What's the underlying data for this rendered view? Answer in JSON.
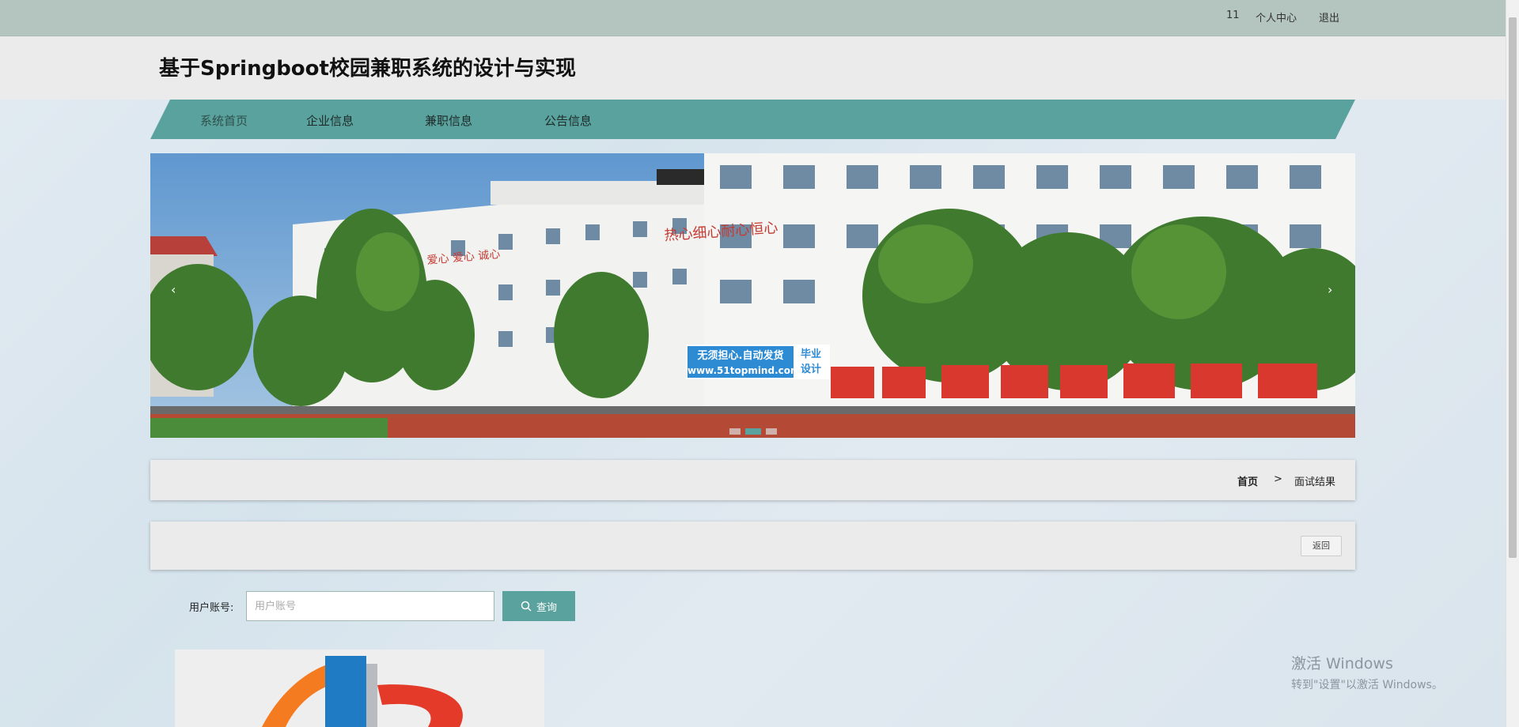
{
  "topbar": {
    "user": "11",
    "profile": "个人中心",
    "logout": "退出"
  },
  "header": {
    "title": "基于Springboot校园兼职系统的设计与实现"
  },
  "nav": {
    "items": [
      {
        "label": "系统首页"
      },
      {
        "label": "企业信息"
      },
      {
        "label": "兼职信息"
      },
      {
        "label": "公告信息"
      }
    ]
  },
  "banner": {
    "prev_icon": "chevron-left-icon",
    "next_icon": "chevron-right-icon",
    "slide_count": 3,
    "active_slide": 2,
    "stamp": {
      "line1": "无须担心.自动发货",
      "line2": "www.51topmind.com",
      "right1": "毕业",
      "right2": "设计"
    },
    "sign_left": "爱心 爱心 诚心",
    "sign_right": "热心细心耐心恒心"
  },
  "breadcrumb": {
    "home": "首页",
    "separator": ">",
    "current": "面试结果"
  },
  "actions": {
    "back": "返回"
  },
  "search": {
    "label": "用户账号:",
    "placeholder": "用户账号",
    "button": "查询",
    "icon": "search-icon"
  },
  "watermark": {
    "line1": "激活 Windows",
    "line2": "转到\"设置\"以激活 Windows。"
  },
  "colors": {
    "primary": "#5aa29d",
    "topbar": "#b3c5be",
    "header": "#ebebeb"
  }
}
